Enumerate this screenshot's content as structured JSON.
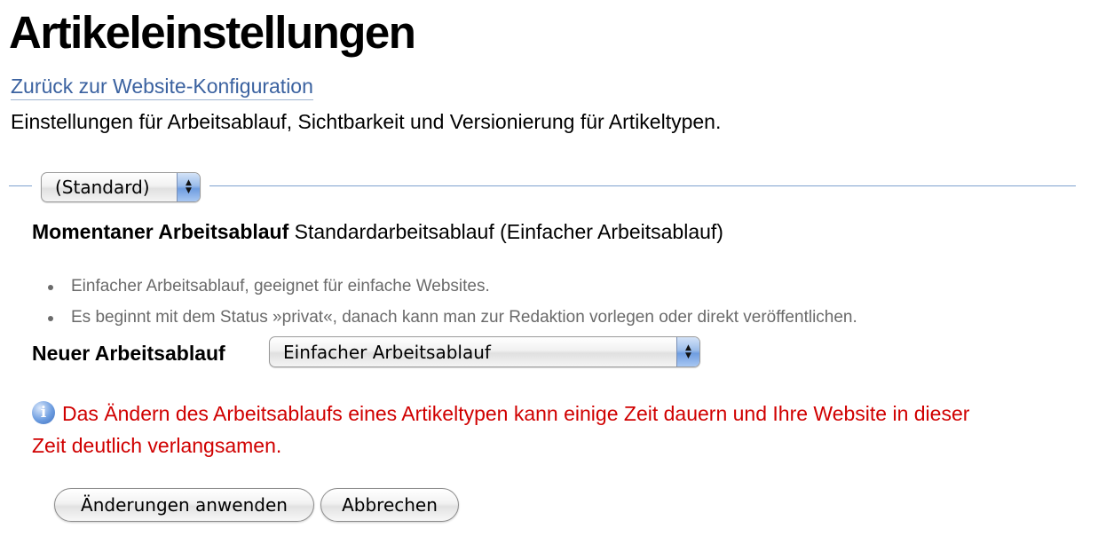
{
  "page": {
    "title": "Artikeleinstellungen",
    "back_link": "Zurück zur Website-Konfiguration",
    "description": "Einstellungen für Arbeitsablauf, Sichtbarkeit und Versionierung für Artikeltypen."
  },
  "type_select": {
    "value": "(Standard)"
  },
  "current_workflow": {
    "label": "Momentaner Arbeitsablauf",
    "value": "Standardarbeitsablauf (Einfacher Arbeitsablauf)"
  },
  "workflow_notes": [
    "Einfacher Arbeitsablauf, geeignet für einfache Websites.",
    "Es beginnt mit dem Status »privat«, danach kann man zur Redaktion vorlegen oder direkt veröffentlichen."
  ],
  "new_workflow": {
    "label": "Neuer Arbeitsablauf",
    "value": "Einfacher Arbeitsablauf"
  },
  "warning": {
    "icon": "info-icon",
    "text": "Das Ändern des Arbeitsablaufs eines Artikeltypen kann einige Zeit dauern und Ihre Website in dieser Zeit deutlich verlangsamen."
  },
  "buttons": {
    "apply": "Änderungen anwenden",
    "cancel": "Abbrechen"
  },
  "colors": {
    "link": "#3b62a0",
    "rule": "#7ea1cf",
    "warning": "#d00000",
    "note": "#6a6a6a"
  }
}
